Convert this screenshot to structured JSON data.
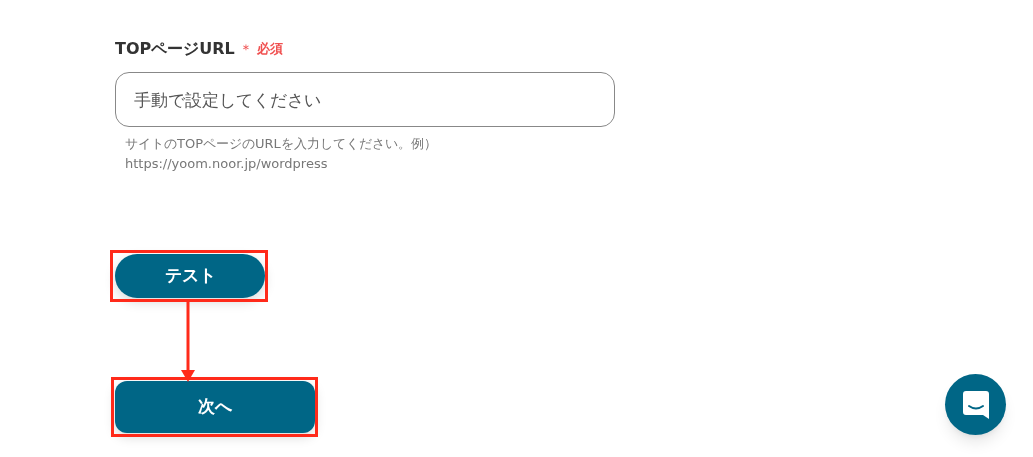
{
  "field": {
    "label": "TOPページURL",
    "required_mark": "＊",
    "required_text": "必須",
    "placeholder": "手動で設定してください",
    "help": [
      "サイトのTOPページのURLを入力してください。例）",
      "https://yoom.noor.jp/wordpress"
    ]
  },
  "buttons": [
    {
      "label": "テスト",
      "kind": "pill"
    },
    {
      "label": "次へ",
      "kind": "rounded"
    }
  ]
}
